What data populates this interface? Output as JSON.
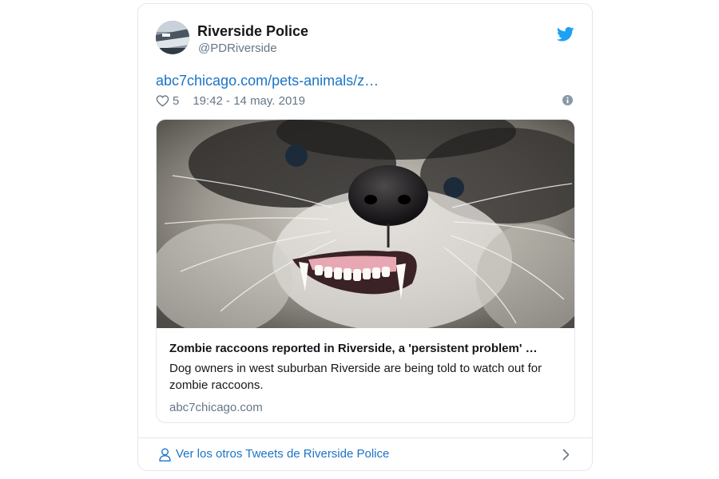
{
  "user": {
    "name": "Riverside Police",
    "handle": "@PDRiverside"
  },
  "tweet": {
    "link_text": "abc7chicago.com/pets-animals/z…",
    "likes": "5",
    "timestamp": "19:42 - 14 may. 2019"
  },
  "card": {
    "title": "Zombie raccoons reported in Riverside, a 'persistent problem' …",
    "description": "Dog owners in west suburban Riverside are being told to watch out for zombie raccoons.",
    "domain": "abc7chicago.com"
  },
  "footer": {
    "label": "Ver los otros Tweets de Riverside Police"
  },
  "colors": {
    "link_blue": "#1b74c5",
    "twitter_blue": "#1da1f2",
    "text_primary": "#14171a",
    "text_secondary": "#657786",
    "border": "#e1e8ed"
  },
  "icons": [
    "twitter-bird-icon",
    "heart-icon",
    "info-icon",
    "person-icon",
    "chevron-right-icon"
  ]
}
